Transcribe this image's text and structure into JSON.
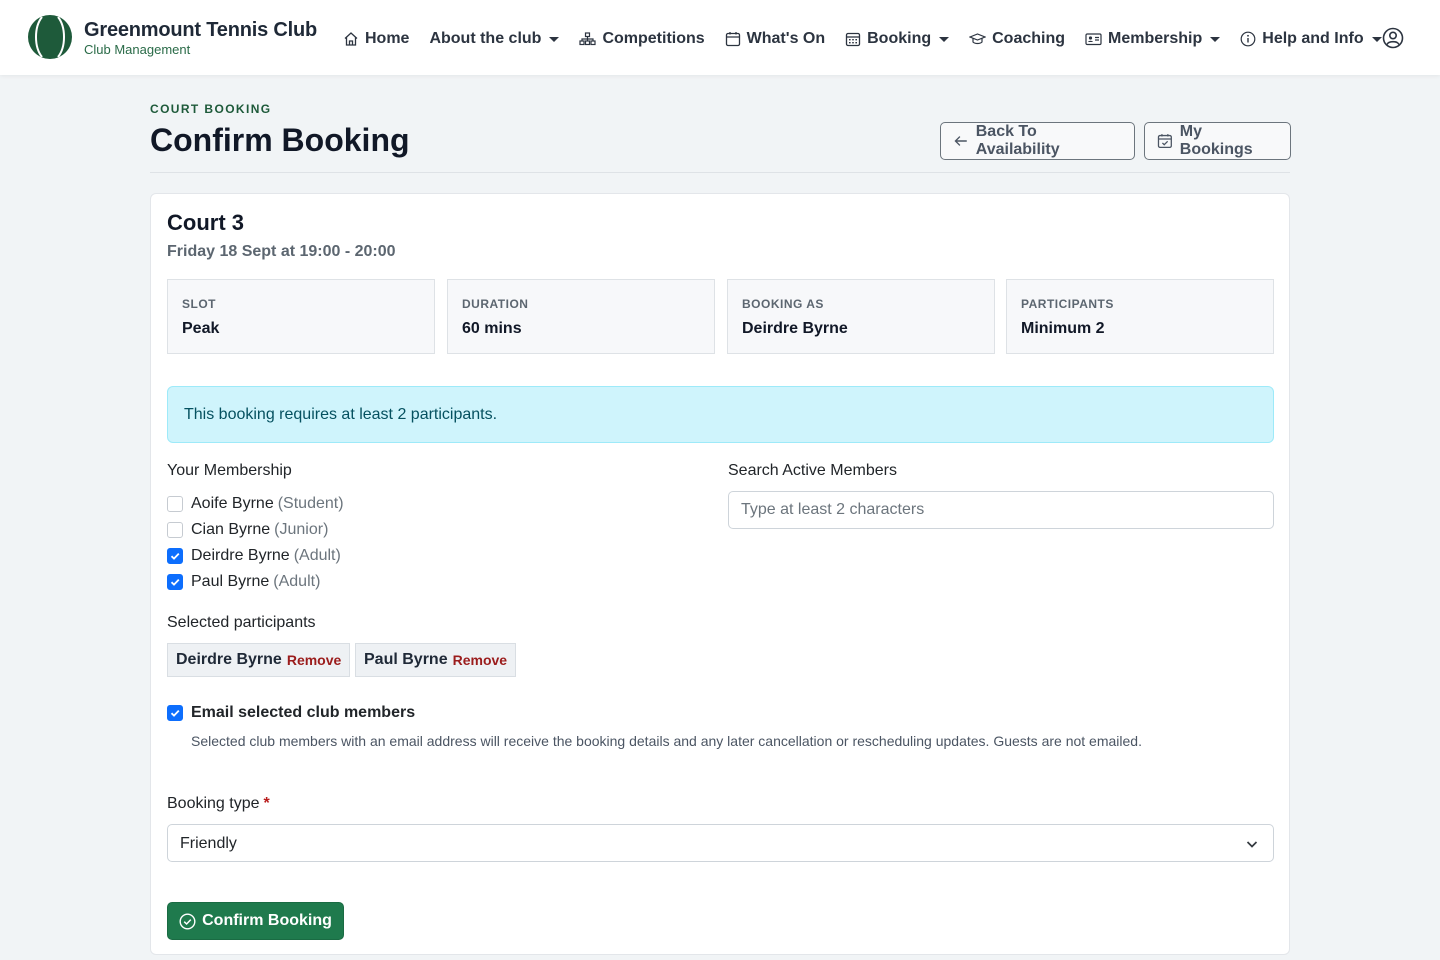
{
  "brand": {
    "name": "Greenmount Tennis Club",
    "subtitle": "Club Management",
    "logo_color": "#1e5a3a"
  },
  "nav": {
    "items": [
      {
        "label": "Home",
        "icon": "home-icon"
      },
      {
        "label": "About the club",
        "icon": "",
        "dropdown": true
      },
      {
        "label": "Competitions",
        "icon": "sitemap-icon"
      },
      {
        "label": "What's On",
        "icon": "calendar-icon"
      },
      {
        "label": "Booking",
        "icon": "grid-calendar-icon",
        "dropdown": true
      },
      {
        "label": "Coaching",
        "icon": "mortarboard-icon"
      },
      {
        "label": "Membership",
        "icon": "id-card-icon",
        "dropdown": true
      },
      {
        "label": "Help and Info",
        "icon": "info-icon",
        "dropdown": true
      }
    ],
    "user_icon": "user-circle-icon"
  },
  "header": {
    "eyebrow": "COURT BOOKING",
    "title": "Confirm Booking",
    "back_label": "Back To Availability",
    "my_bookings_label": "My Bookings"
  },
  "booking": {
    "court": "Court 3",
    "datetime": "Friday 18 Sept at 19:00 - 20:00",
    "info": [
      {
        "label": "SLOT",
        "value": "Peak"
      },
      {
        "label": "DURATION",
        "value": "60 mins"
      },
      {
        "label": "BOOKING AS",
        "value": "Deirdre Byrne"
      },
      {
        "label": "PARTICIPANTS",
        "value": "Minimum 2"
      }
    ],
    "alert": "This booking requires at least 2 participants."
  },
  "membership": {
    "label": "Your Membership",
    "members": [
      {
        "name": "Aoife Byrne",
        "role": "(Student)",
        "checked": false
      },
      {
        "name": "Cian Byrne",
        "role": "(Junior)",
        "checked": false
      },
      {
        "name": "Deirdre Byrne",
        "role": "(Adult)",
        "checked": true
      },
      {
        "name": "Paul Byrne",
        "role": "(Adult)",
        "checked": true
      }
    ]
  },
  "search": {
    "label": "Search Active Members",
    "placeholder": "Type at least 2 characters",
    "value": ""
  },
  "selected": {
    "label": "Selected participants",
    "chips": [
      {
        "name": "Deirdre Byrne",
        "remove": "Remove"
      },
      {
        "name": "Paul Byrne",
        "remove": "Remove"
      }
    ]
  },
  "email": {
    "label": "Email selected club members",
    "checked": true,
    "help": "Selected club members with an email address will receive the booking details and any later cancellation or rescheduling updates. Guests are not emailed."
  },
  "booking_type": {
    "label": "Booking type",
    "required_mark": "*",
    "value": "Friendly"
  },
  "confirm_label": "Confirm Booking",
  "colors": {
    "primary": "#1f7a4d",
    "accent_blue": "#0d6efd",
    "alert_bg": "#cff4fc",
    "remove_red": "#9b1c1c"
  }
}
